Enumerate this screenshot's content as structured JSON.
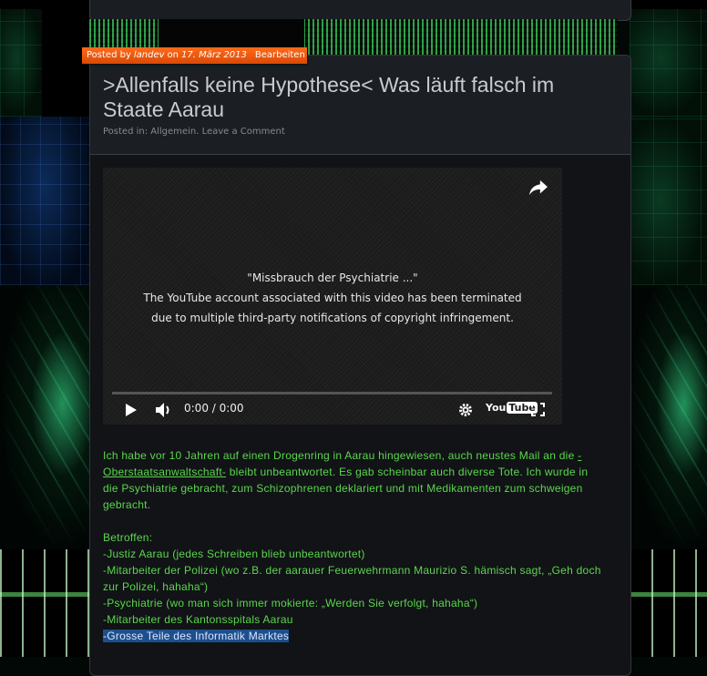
{
  "meta": {
    "posted_by_label": "Posted by",
    "author": "landev",
    "on_label": "on",
    "date": "17. März 2013",
    "edit_label": "Bearbeiten"
  },
  "post": {
    "title": ">Allenfalls keine Hypothese< Was läuft falsch im Staate Aarau",
    "posted_in_label": "Posted in:",
    "category": "Allgemein.",
    "comment_link": "Leave a Comment"
  },
  "video": {
    "title": "\"Missbrauch der Psychiatrie ...\"",
    "message_line1": "The YouTube account associated with this video has been terminated",
    "message_line2": "due to multiple third-party notifications of copyright infringement.",
    "time": "0:00 / 0:00",
    "logo_you": "You",
    "logo_tube": "Tube"
  },
  "content": {
    "para1_before": "Ich habe vor 10 Jahren auf einen Drogenring in Aarau hingewiesen, auch neustes Mail an die ",
    "para1_link": "-Oberstaatsanwaltschaft-",
    "para1_after": " bleibt unbeantwortet. Es gab scheinbar auch diverse Tote. Ich wurde in die Psychiatrie gebracht, zum Schizophrenen deklariert und mit Medikamenten zum schweigen gebracht.",
    "affected_heading": "Betroffen:",
    "affected": [
      "-Justiz Aarau (jedes Schreiben blieb unbeantwortet)",
      "-Mitarbeiter der Polizei (wo z.B. der aarauer Feuerwehrmann Maurizio S. hämisch sagt, „Geh doch zur Polizei, hahaha“)",
      "-Psychiatrie (wo man sich immer mokierte: „Werden Sie verfolgt, hahaha“)",
      "-Mitarbeiter des Kantonsspitals Aarau"
    ],
    "selected_line": "-Grosse Teile des Informatik Marktes"
  },
  "colors": {
    "accent_orange": "#e85a10",
    "text_green": "#5bd64d",
    "selection": "#1d4f8c"
  }
}
